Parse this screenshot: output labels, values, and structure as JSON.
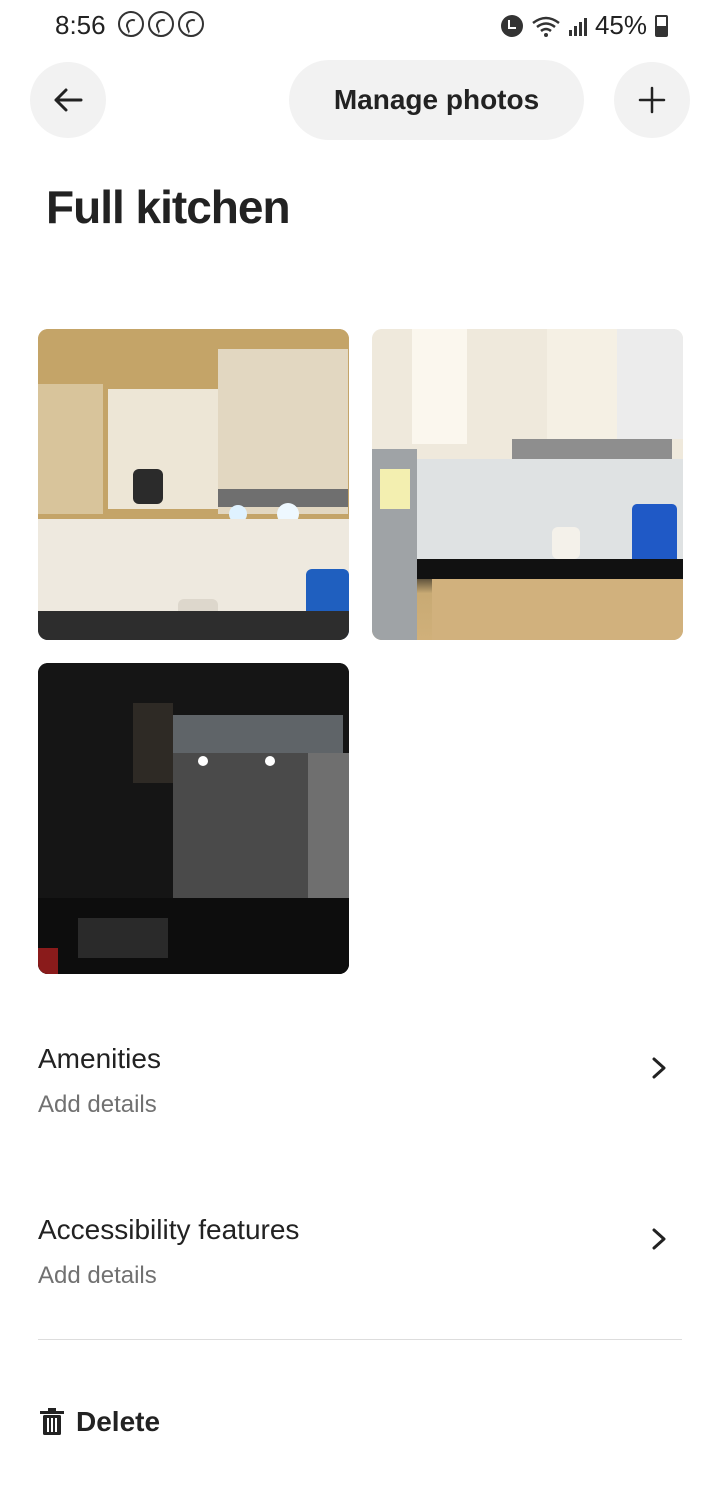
{
  "status_bar": {
    "time": "8:56",
    "battery": "45%",
    "notification_icons": [
      "viber-icon",
      "viber-icon",
      "viber-icon"
    ],
    "system_icons": [
      "alarm-icon",
      "wifi-icon",
      "signal-icon",
      "battery-icon"
    ]
  },
  "header": {
    "back_icon": "arrow-left-icon",
    "manage_label": "Manage photos",
    "add_icon": "plus-icon"
  },
  "page_title": "Full kitchen",
  "photos": [
    {
      "id": "photo-1"
    },
    {
      "id": "photo-2"
    },
    {
      "id": "photo-3"
    }
  ],
  "sections": [
    {
      "title": "Amenities",
      "subtitle": "Add details",
      "icon": "chevron-right-icon"
    },
    {
      "title": "Accessibility features",
      "subtitle": "Add details",
      "icon": "chevron-right-icon"
    }
  ],
  "delete": {
    "label": "Delete",
    "icon": "trash-icon"
  },
  "colors": {
    "text_primary": "#222222",
    "text_secondary": "#717171",
    "button_bg": "#f2f2f2",
    "divider": "#dddddd"
  }
}
